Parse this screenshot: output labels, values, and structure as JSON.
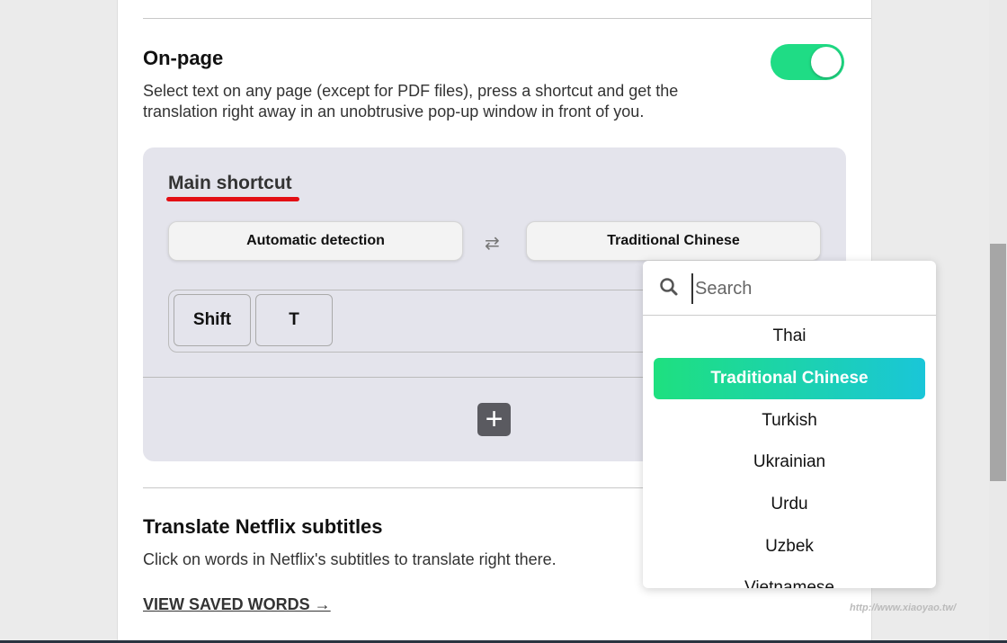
{
  "onpage": {
    "title": "On-page",
    "description": "Select text on any page (except for PDF files), press a shortcut and get the translation right away in an unobtrusive pop-up window in front of you.",
    "enabled": true
  },
  "shortcut": {
    "title": "Main shortcut",
    "source_lang": "Automatic detection",
    "target_lang": "Traditional Chinese",
    "keys": [
      "Shift",
      "T"
    ]
  },
  "netflix": {
    "title": "Translate Netflix subtitles",
    "description": "Click on words in Netflix's subtitles to translate right there.",
    "link": "VIEW SAVED WORDS →"
  },
  "dropdown": {
    "search_placeholder": "Search",
    "options": [
      "Thai",
      "Traditional Chinese",
      "Turkish",
      "Ukrainian",
      "Urdu",
      "Uzbek",
      "Vietnamese"
    ],
    "selected": "Traditional Chinese"
  },
  "colors": {
    "accent": "#1fdc85",
    "gradient_end": "#1ac6d8",
    "underline": "#e30f14"
  },
  "watermark": "http://www.xiaoyao.tw/"
}
